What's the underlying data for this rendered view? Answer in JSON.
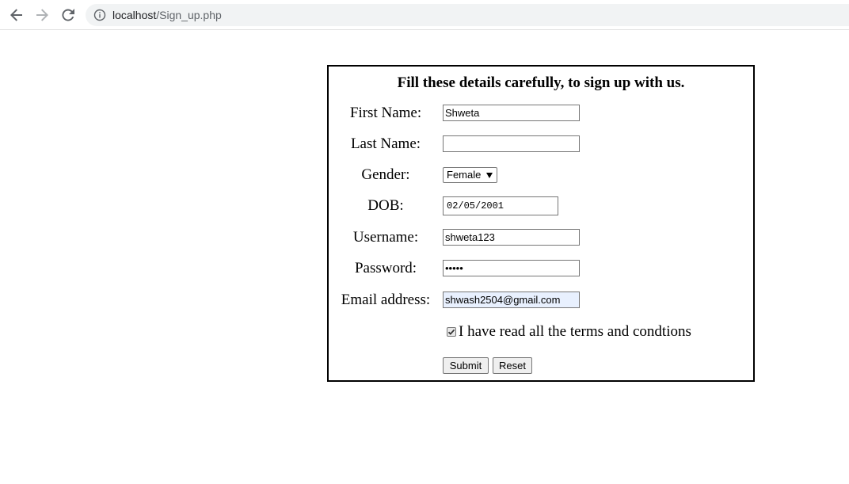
{
  "browser": {
    "url_host": "localhost",
    "url_path": "/Sign_up.php",
    "icons": {
      "back": "arrow-left-icon",
      "forward": "arrow-right-icon",
      "reload": "reload-icon",
      "site_info": "info-icon"
    }
  },
  "form": {
    "heading": "Fill these details carefully, to sign up with us.",
    "first_name": {
      "label": "First Name:",
      "value": "Shweta"
    },
    "last_name": {
      "label": "Last Name:",
      "value": ""
    },
    "gender": {
      "label": "Gender:",
      "selected": "Female"
    },
    "dob": {
      "label": "DOB:",
      "value": "02/05/2001"
    },
    "username": {
      "label": "Username:",
      "value": "shweta123"
    },
    "password": {
      "label": "Password:",
      "masked_value": "•••••"
    },
    "email": {
      "label": "Email address:",
      "value": "shwash2504@gmail.com"
    },
    "terms": {
      "label": "I have read all the terms and condtions",
      "checked": true
    },
    "submit_label": "Submit",
    "reset_label": "Reset"
  },
  "colors": {
    "autofill_background": "#e8f0fe",
    "border": "#000000",
    "omnibox_background": "#f1f3f4"
  }
}
